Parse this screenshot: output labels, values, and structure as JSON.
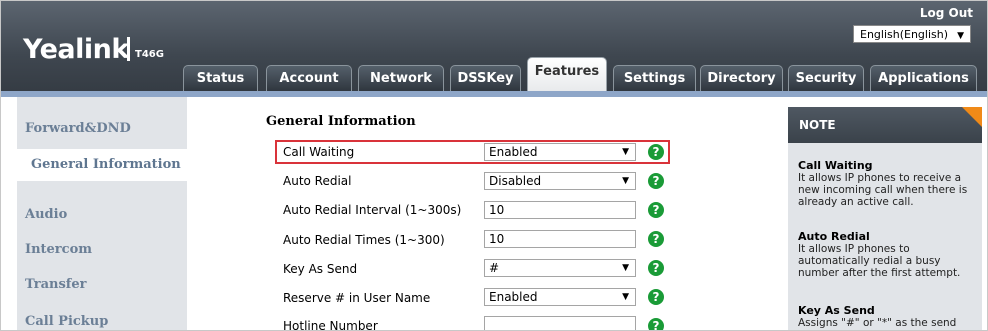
{
  "header": {
    "brand": "Yealink",
    "model": "T46G",
    "logout_label": "Log Out",
    "language": "English(English)"
  },
  "tabs": [
    {
      "label": "Status"
    },
    {
      "label": "Account"
    },
    {
      "label": "Network"
    },
    {
      "label": "DSSKey"
    },
    {
      "label": "Features",
      "active": true
    },
    {
      "label": "Settings"
    },
    {
      "label": "Directory"
    },
    {
      "label": "Security"
    },
    {
      "label": "Applications"
    }
  ],
  "sidebar": {
    "items": [
      {
        "label": "Forward&DND"
      },
      {
        "label": "General Information",
        "active": true
      },
      {
        "label": "Audio"
      },
      {
        "label": "Intercom"
      },
      {
        "label": "Transfer"
      },
      {
        "label": "Call Pickup"
      }
    ]
  },
  "main": {
    "section_title": "General Information",
    "rows": [
      {
        "label": "Call Waiting",
        "type": "select",
        "value": "Enabled"
      },
      {
        "label": "Auto Redial",
        "type": "select",
        "value": "Disabled"
      },
      {
        "label": "Auto Redial Interval (1~300s)",
        "type": "input",
        "value": "10"
      },
      {
        "label": "Auto Redial Times (1~300)",
        "type": "input",
        "value": "10"
      },
      {
        "label": "Key As Send",
        "type": "select",
        "value": "#"
      },
      {
        "label": "Reserve # in User Name",
        "type": "select",
        "value": "Enabled"
      },
      {
        "label": "Hotline Number",
        "type": "input",
        "value": ""
      }
    ],
    "help_glyph": "?"
  },
  "note": {
    "title": "NOTE",
    "entries": [
      {
        "title": "Call Waiting",
        "text": "It allows IP phones to receive a new incoming call when there is already an active call."
      },
      {
        "title": "Auto Redial",
        "text": "It allows IP phones to automatically redial a busy number after the first attempt."
      },
      {
        "title": "Key As Send",
        "text": "Assigns \"#\" or \"*\" as the send"
      }
    ]
  },
  "colors": {
    "accent_orange": "#f08a18",
    "highlight_red": "#d9333a",
    "help_green": "#1a9b37",
    "sidebar_text": "#6b7f96"
  },
  "icons": {
    "dropdown": "chevron-down-icon",
    "help": "help-icon"
  }
}
